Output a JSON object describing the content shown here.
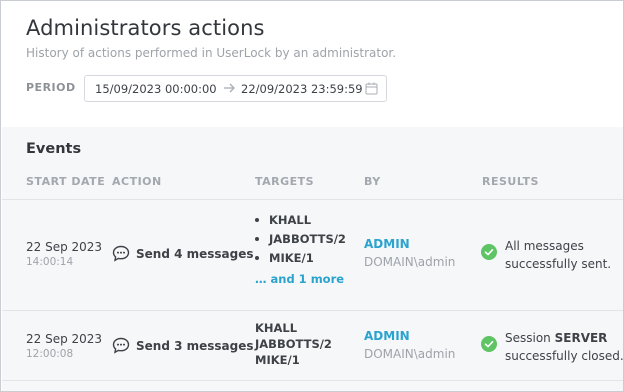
{
  "header": {
    "title": "Administrators actions",
    "subtitle": "History of actions performed in UserLock by an administrator.",
    "period_label": "PERIOD",
    "period_start": "15/09/2023 00:00:00",
    "period_end": "22/09/2023 23:59:59"
  },
  "events": {
    "title": "Events",
    "columns": [
      "START DATE",
      "ACTION",
      "TARGETS",
      "BY",
      "RESULTS"
    ],
    "rows": [
      {
        "date": "22 Sep 2023",
        "time": "14:00:14",
        "action": "Send 4 messages",
        "targets": [
          "KHALL",
          "JABBOTTS/2",
          "MIKE/1"
        ],
        "more": "… and 1 more",
        "by_name": "ADMIN",
        "by_domain": "DOMAIN\\admin",
        "result_line1": "All messages",
        "result_line2": "successfully sent."
      },
      {
        "date": "22 Sep 2023",
        "time": "12:00:08",
        "action": "Send 3 messages",
        "targets": [
          "KHALL",
          "JABBOTTS/2",
          "MIKE/1"
        ],
        "by_name": "ADMIN",
        "by_domain": "DOMAIN\\admin",
        "result_prefix": "Session ",
        "result_bold": "SERVER",
        "result_line2": "successfully closed."
      }
    ]
  },
  "colors": {
    "accent": "#2aa3cf",
    "success": "#5fc463",
    "panel_bg": "#f6f7f9"
  },
  "icons": [
    "arrow-right-icon",
    "calendar-icon",
    "chat-bubble-icon",
    "check-circle-icon"
  ]
}
